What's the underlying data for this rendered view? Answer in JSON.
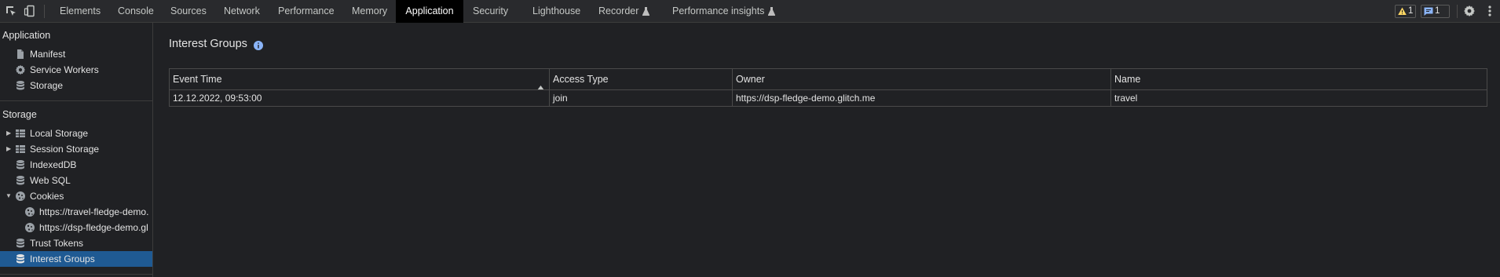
{
  "toolbar": {
    "tabs": [
      {
        "label": "Elements"
      },
      {
        "label": "Console"
      },
      {
        "label": "Sources"
      },
      {
        "label": "Network"
      },
      {
        "label": "Performance"
      },
      {
        "label": "Memory"
      },
      {
        "label": "Application",
        "active": true
      },
      {
        "label": "Security"
      },
      {
        "label": "Lighthouse"
      },
      {
        "label": "Recorder",
        "experimental": true
      },
      {
        "label": "Performance insights",
        "experimental": true
      }
    ],
    "warning_count": "1",
    "message_count": "1",
    "icons": [
      "inspect-element-icon",
      "device-toolbar-icon",
      "warning-icon",
      "message-icon",
      "settings-gear-icon",
      "more-menu-icon",
      "flask-icon"
    ]
  },
  "sidebar": {
    "application_section": {
      "title": "Application",
      "items": [
        {
          "label": "Manifest",
          "icon": "document-icon"
        },
        {
          "label": "Service Workers",
          "icon": "gear-icon"
        },
        {
          "label": "Storage",
          "icon": "database-icon"
        }
      ]
    },
    "storage_section": {
      "title": "Storage",
      "items": [
        {
          "label": "Local Storage",
          "icon": "table-icon",
          "expandable": true
        },
        {
          "label": "Session Storage",
          "icon": "table-icon",
          "expandable": true
        },
        {
          "label": "IndexedDB",
          "icon": "database-icon"
        },
        {
          "label": "Web SQL",
          "icon": "database-icon"
        },
        {
          "label": "Cookies",
          "icon": "cookie-icon",
          "expanded": true
        },
        {
          "label": "https://travel-fledge-demo.",
          "icon": "cookie-icon",
          "child": true
        },
        {
          "label": "https://dsp-fledge-demo.gl",
          "icon": "cookie-icon",
          "child": true
        },
        {
          "label": "Trust Tokens",
          "icon": "database-icon"
        },
        {
          "label": "Interest Groups",
          "icon": "database-icon",
          "selected": true
        }
      ]
    }
  },
  "main": {
    "title": "Interest Groups",
    "table": {
      "columns": [
        "Event Time",
        "Access Type",
        "Owner",
        "Name"
      ],
      "sorted_column": "Event Time",
      "sort_direction": "ascending",
      "rows": [
        [
          "12.12.2022, 09:53:00",
          "join",
          "https://dsp-fledge-demo.glitch.me",
          "travel"
        ]
      ]
    }
  },
  "colors": {
    "toolbar_bg": "#292a2d",
    "panel_bg": "#202124",
    "selected_row": "#1f5a93",
    "active_tab": "#000000",
    "info_blue": "#8ab4f8",
    "warning_yellow": "#fdd663"
  }
}
